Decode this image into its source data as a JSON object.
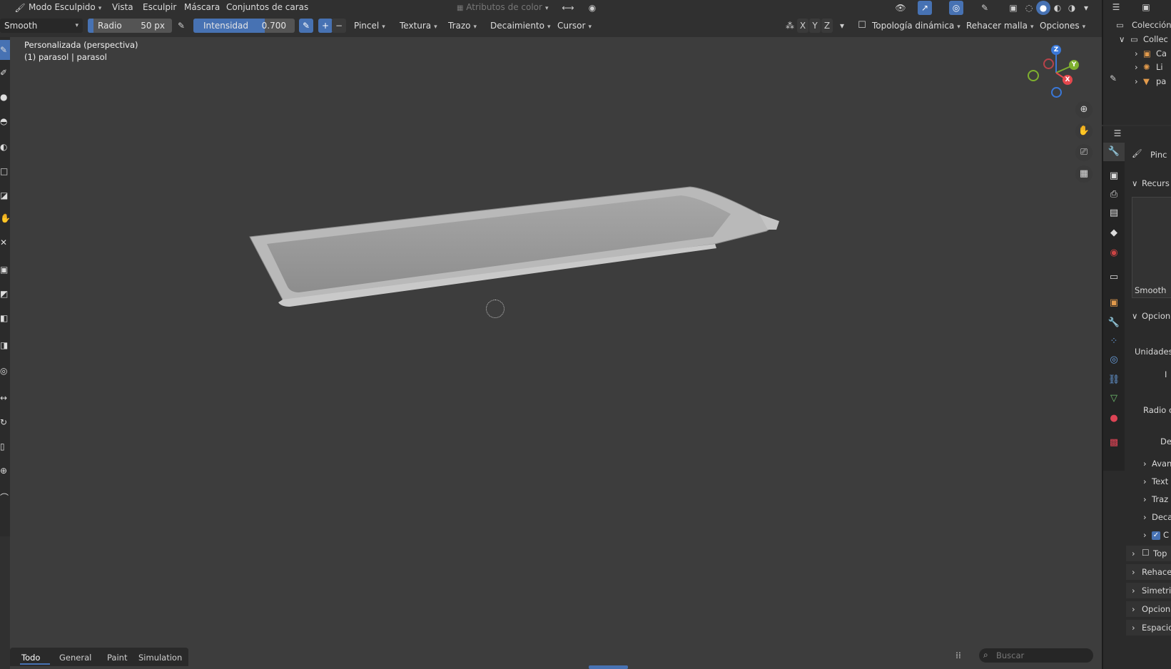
{
  "header": {
    "mode_label": "Modo Esculpido",
    "menus": [
      "Vista",
      "Esculpir",
      "Máscara",
      "Conjuntos de caras"
    ],
    "color_attributes_label": "Atributos de color"
  },
  "tool_settings": {
    "brush_name": "Smooth",
    "radius_label": "Radio",
    "radius_value": "50 px",
    "strength_label": "Intensidad",
    "strength_value": "0.700",
    "dropdowns": [
      "Pincel",
      "Textura",
      "Trazo",
      "Decaimiento",
      "Cursor"
    ],
    "symmetry_axes": [
      "X",
      "Y",
      "Z"
    ],
    "dyntopo_label": "Topología dinámica",
    "remesh_label": "Rehacer malla",
    "options_label": "Opciones"
  },
  "viewport": {
    "view_name": "Personalizada (perspectiva)",
    "object_info": "(1) parasol | parasol",
    "gizmo_axes": [
      "Z",
      "Y",
      "X"
    ]
  },
  "outliner": {
    "root_label": "Colección",
    "collection_label": "Collec",
    "items": [
      "Ca",
      "Li",
      "pa"
    ]
  },
  "properties": {
    "tool_header": "Pinc",
    "sections": {
      "brushes": "Recurs",
      "brush_name": "Smooth",
      "options": "Opcion",
      "units": "Unidades",
      "field_i": "I",
      "radius": "Radio c",
      "def": "Def"
    },
    "subpanels": [
      "Avan",
      "Text",
      "Traz",
      "Deca",
      "C"
    ],
    "panels": [
      "Top",
      "Rehace",
      "Simetri",
      "Opcion",
      "Espacio"
    ]
  },
  "bottom_bar": {
    "tabs": [
      "Todo",
      "General",
      "Paint",
      "Simulation"
    ],
    "search_placeholder": "Buscar"
  },
  "colors": {
    "accent": "#4772b3",
    "viewport_bg": "#3d3d3d",
    "axis_x": "#e5484d",
    "axis_y": "#7fb02f",
    "axis_z": "#3a78d8"
  }
}
